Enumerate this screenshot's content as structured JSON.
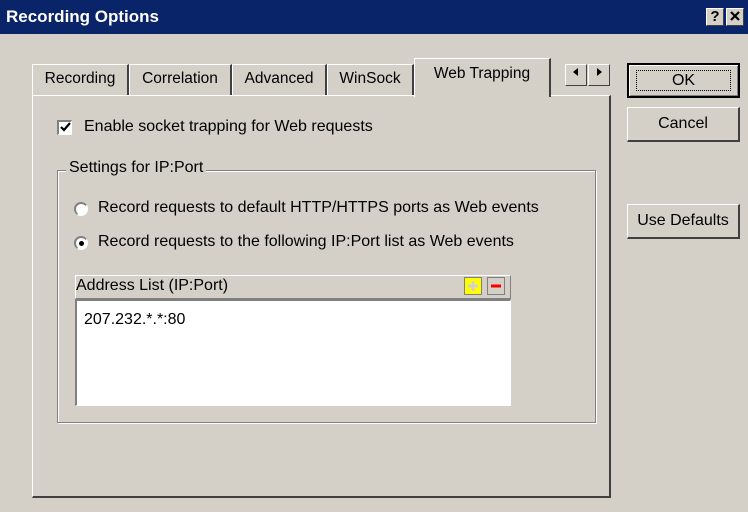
{
  "window": {
    "title": "Recording Options",
    "help_label": "?",
    "close_label": "✕"
  },
  "tabs": [
    {
      "label": "Recording",
      "active": false
    },
    {
      "label": "Correlation",
      "active": false
    },
    {
      "label": "Advanced",
      "active": false
    },
    {
      "label": "WinSock",
      "active": false
    },
    {
      "label": "Web Trapping",
      "active": true
    }
  ],
  "tab_scroll": {
    "left_icon": "arrow-left-icon",
    "right_icon": "arrow-right-icon"
  },
  "settings": {
    "enable_socket_trapping": {
      "label": "Enable socket trapping for Web requests",
      "checked": true
    },
    "group_title": "Settings for IP:Port",
    "radio_options": [
      {
        "label": "Record requests to default HTTP/HTTPS ports as Web events",
        "selected": false
      },
      {
        "label": "Record requests to the following IP:Port list as Web events",
        "selected": true
      }
    ],
    "address_list": {
      "header": "Address List (IP:Port)",
      "add_icon": "plus-icon",
      "remove_icon": "minus-icon",
      "items": [
        "207.232.*.*:80"
      ]
    }
  },
  "buttons": {
    "ok": "OK",
    "cancel": "Cancel",
    "use_defaults": "Use Defaults"
  },
  "colors": {
    "titlebar": "#0a246a",
    "dialog_bg": "#d4d0c8",
    "add_icon": "#ffff00",
    "remove_icon": "#ff0000"
  }
}
